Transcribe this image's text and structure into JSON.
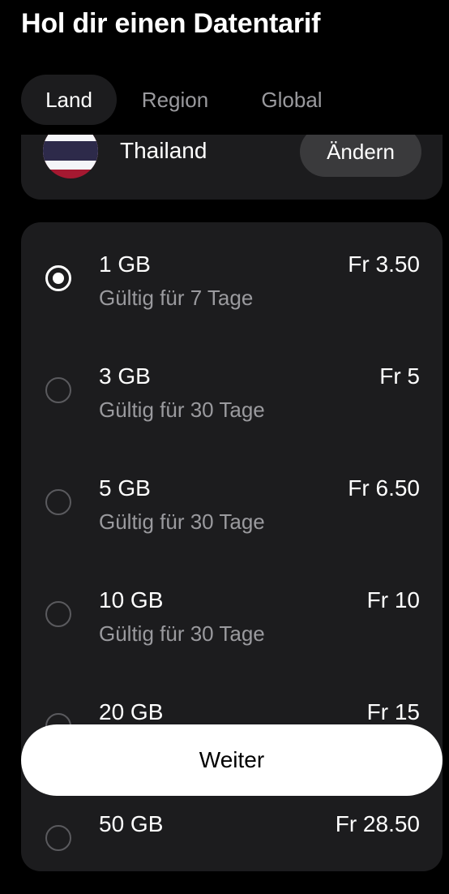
{
  "header": {
    "title": "Hol dir einen Datentarif"
  },
  "tabs": [
    {
      "label": "Land",
      "active": true
    },
    {
      "label": "Region",
      "active": false
    },
    {
      "label": "Global",
      "active": false
    }
  ],
  "country": {
    "name": "Thailand",
    "change_label": "Ändern",
    "flag_icon": "thailand-flag-icon",
    "flag_colors": [
      "#a51931",
      "#f4f5f8",
      "#2d2a4a"
    ]
  },
  "plans": [
    {
      "size": "1 GB",
      "validity": "Gültig für 7 Tage",
      "price": "Fr 3.50",
      "selected": true
    },
    {
      "size": "3 GB",
      "validity": "Gültig für 30 Tage",
      "price": "Fr 5",
      "selected": false
    },
    {
      "size": "5 GB",
      "validity": "Gültig für 30 Tage",
      "price": "Fr 6.50",
      "selected": false
    },
    {
      "size": "10 GB",
      "validity": "Gültig für 30 Tage",
      "price": "Fr 10",
      "selected": false
    },
    {
      "size": "20 GB",
      "validity": "",
      "price": "Fr 15",
      "selected": false
    },
    {
      "size": "50 GB",
      "validity": "",
      "price": "Fr 28.50",
      "selected": false
    }
  ],
  "footer": {
    "continue_label": "Weiter"
  },
  "colors": {
    "background": "#000000",
    "card": "#1c1c1e",
    "button": "#3a3a3c",
    "muted_text": "#9a9a9e"
  }
}
